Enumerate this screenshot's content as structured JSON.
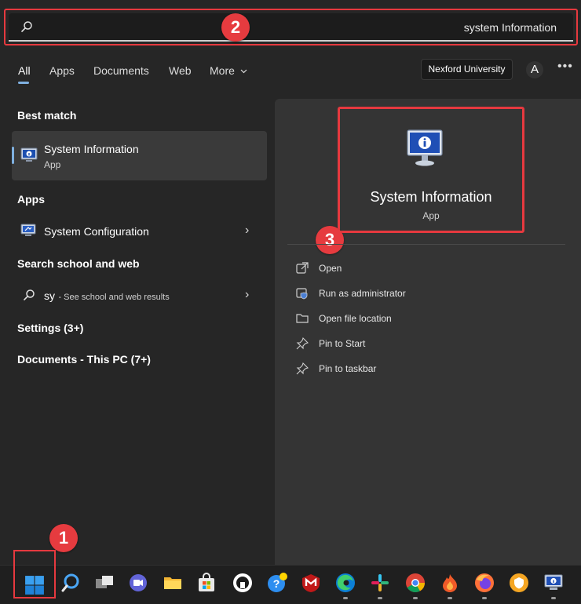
{
  "search": {
    "value": "system Information"
  },
  "callouts": [
    "1",
    "2",
    "3"
  ],
  "tabs": [
    {
      "label": "All"
    },
    {
      "label": "Apps"
    },
    {
      "label": "Documents"
    },
    {
      "label": "Web"
    },
    {
      "label": "More"
    }
  ],
  "header": {
    "org": "Nexford University",
    "avatar": "A"
  },
  "left": {
    "best_match_heading": "Best match",
    "best_match": {
      "title": "System Information",
      "subtitle": "App"
    },
    "apps_heading": "Apps",
    "apps": [
      {
        "title": "System Configuration"
      }
    ],
    "web_heading": "Search school and web",
    "web_result": {
      "query": "sy",
      "hint": "- See school and web results"
    },
    "settings": "Settings (3+)",
    "documents": "Documents - This PC (7+)"
  },
  "right": {
    "title": "System Information",
    "subtitle": "App",
    "actions": [
      {
        "label": "Open",
        "icon": "open-external-icon"
      },
      {
        "label": "Run as administrator",
        "icon": "shield-admin-icon"
      },
      {
        "label": "Open file location",
        "icon": "folder-icon"
      },
      {
        "label": "Pin to Start",
        "icon": "pin-icon"
      },
      {
        "label": "Pin to taskbar",
        "icon": "pin-icon"
      }
    ]
  },
  "taskbar": {
    "icons": [
      "windows-start-icon",
      "search-icon",
      "task-view-icon",
      "teams-chat-icon",
      "file-explorer-icon",
      "microsoft-store-icon",
      "github-desktop-icon",
      "help-icon",
      "mcafee-icon",
      "edge-icon",
      "slack-icon",
      "chrome-icon",
      "fire-app-icon",
      "firefox-icon",
      "vpn-icon",
      "system-information-icon"
    ]
  },
  "colors": {
    "highlight": "#e6393f",
    "accent": "#7fb0e0",
    "background": "#262626",
    "pane": "#343434"
  }
}
